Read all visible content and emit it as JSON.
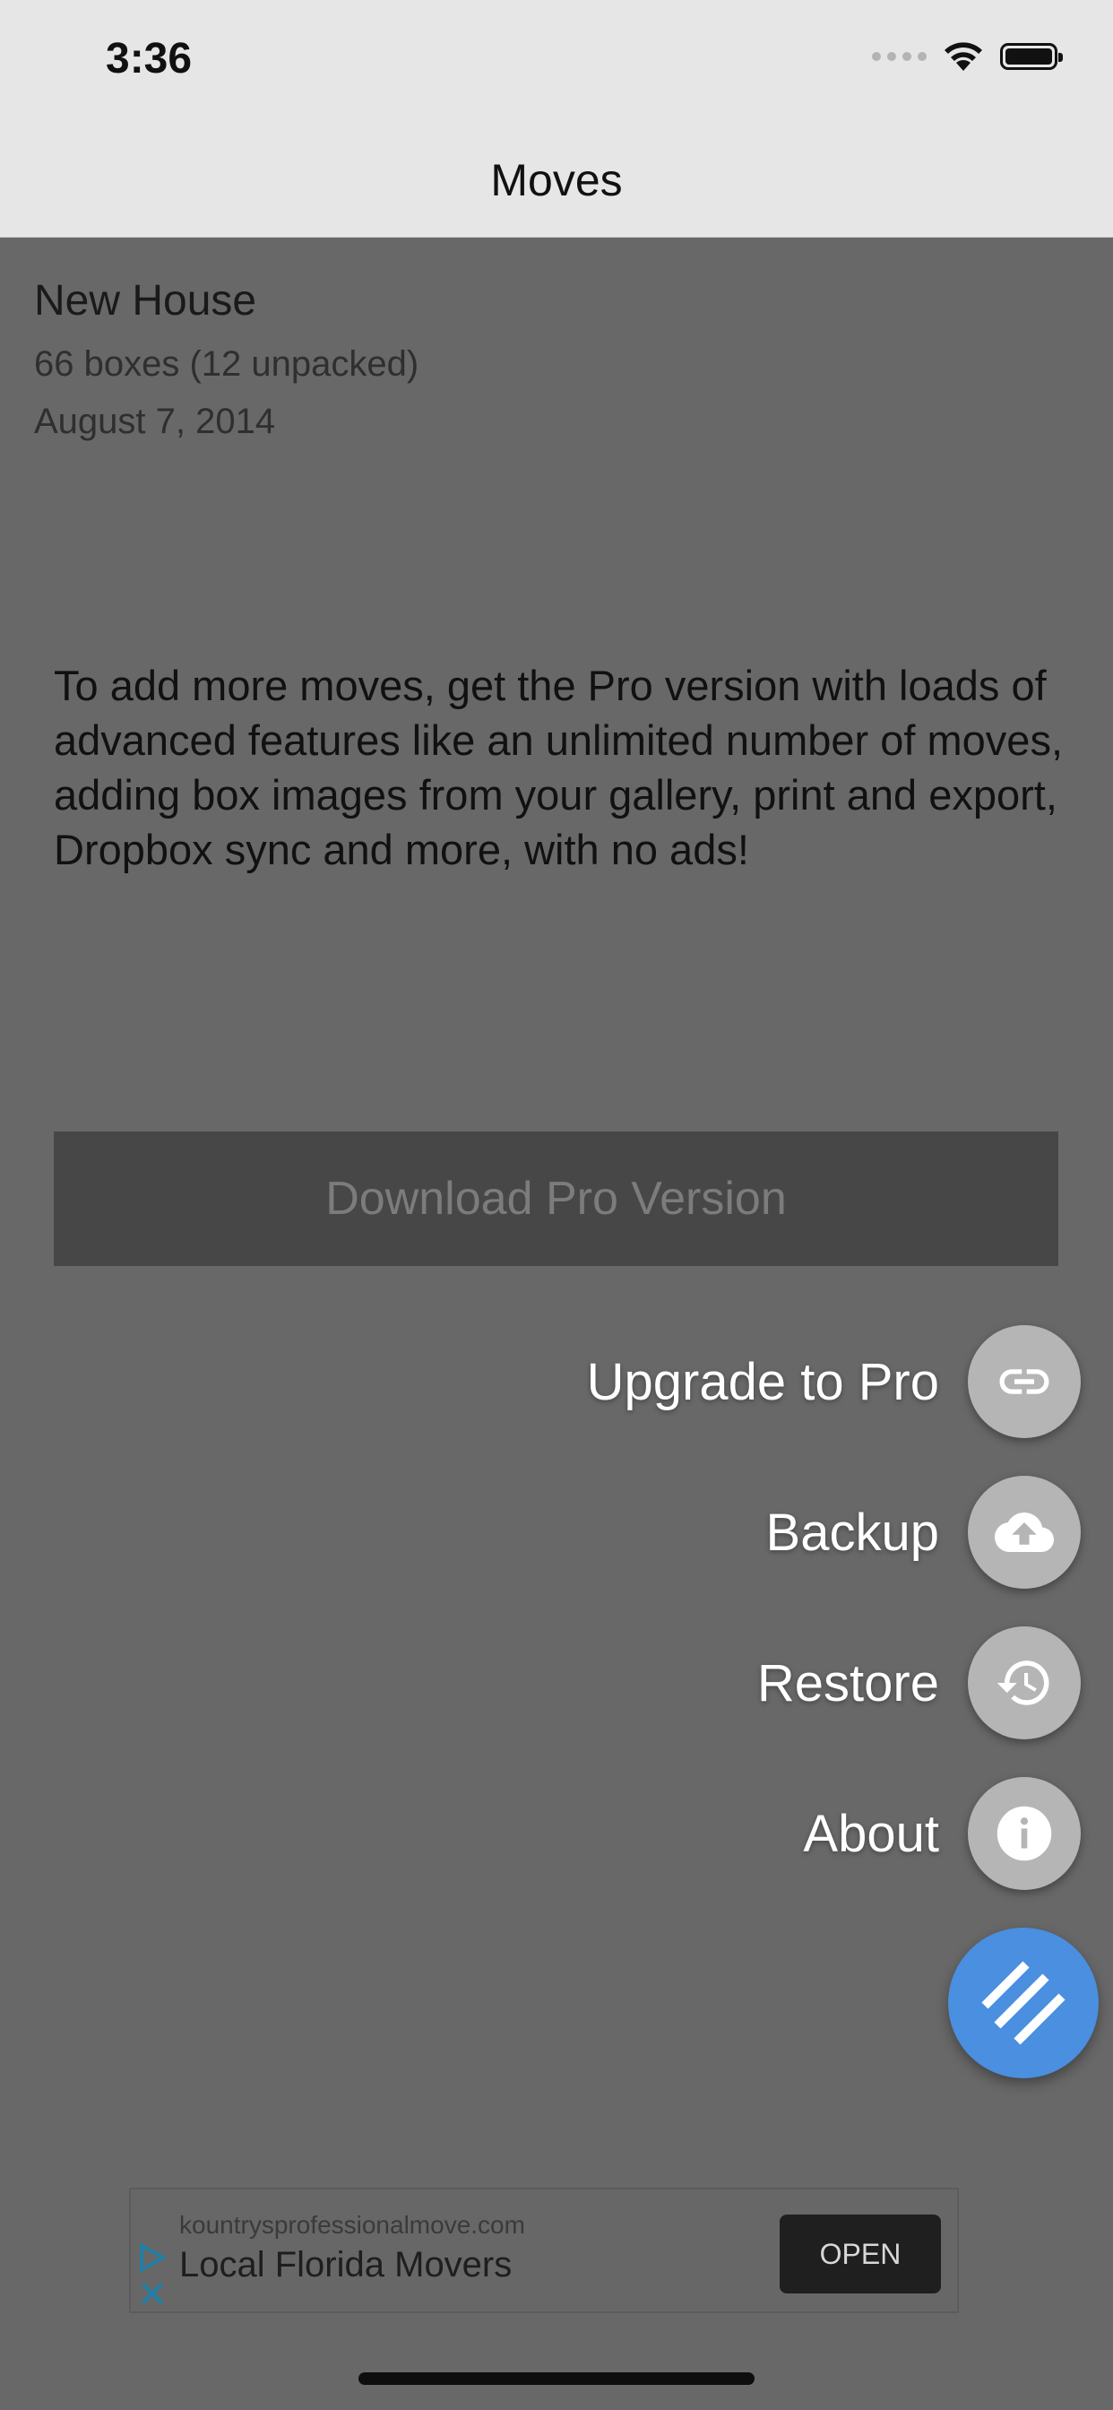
{
  "status_bar": {
    "time": "3:36"
  },
  "nav": {
    "title": "Moves"
  },
  "move": {
    "name": "New House",
    "boxes": "66 boxes (12 unpacked)",
    "date": "August 7, 2014"
  },
  "promo": {
    "text": "To add more moves, get the Pro version with loads of advanced features like an unlimited number of moves, adding box images from your gallery, print and export, Dropbox sync and more, with no ads!",
    "button_label": "Download Pro Version"
  },
  "fab_menu": {
    "items": [
      {
        "label": "Upgrade to Pro",
        "icon": "link-icon"
      },
      {
        "label": "Backup",
        "icon": "cloud-upload-icon"
      },
      {
        "label": "Restore",
        "icon": "history-icon"
      },
      {
        "label": "About",
        "icon": "info-icon"
      }
    ],
    "main_icon": "stripes-icon",
    "main_color": "#4a8fe0"
  },
  "ad": {
    "domain": "kountrysprofessionalmove.com",
    "title": "Local Florida Movers",
    "button_label": "OPEN"
  }
}
